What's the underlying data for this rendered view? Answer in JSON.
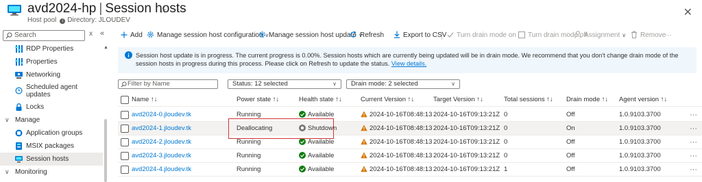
{
  "header": {
    "resource_name": "avd2024-hp",
    "page_name": "Session hosts",
    "separator": "|",
    "subtitle_type": "Host pool",
    "subtitle_directory": "Directory: JLOUDEV",
    "favorite_glyph": "☆",
    "more_glyph": "···",
    "close_glyph": "✕"
  },
  "sidebar": {
    "search_placeholder": "Search",
    "clear_glyph": "x",
    "collapse_glyph": "«",
    "items": [
      {
        "label": "RDP Properties",
        "icon": "rdp-properties-icon"
      },
      {
        "label": "Properties",
        "icon": "properties-icon"
      },
      {
        "label": "Networking",
        "icon": "networking-icon"
      },
      {
        "label": "Scheduled agent updates",
        "icon": "clock-icon"
      },
      {
        "label": "Locks",
        "icon": "lock-icon"
      }
    ],
    "manage_group": "Manage",
    "manage_items": [
      {
        "label": "Application groups",
        "icon": "application-groups-icon"
      },
      {
        "label": "MSIX packages",
        "icon": "msix-packages-icon"
      },
      {
        "label": "Session hosts",
        "icon": "session-hosts-icon",
        "selected": true
      }
    ],
    "monitoring_group": "Monitoring"
  },
  "toolbar": {
    "add": "Add",
    "manage_config": "Manage session host configuration",
    "manage_update": "Manage session host update",
    "refresh": "Refresh",
    "export": "Export to CSV",
    "drain_on": "Turn drain mode on",
    "drain_off": "Turn drain mode off",
    "assignment": "Assignment",
    "remove": "Remove",
    "more": "···"
  },
  "banner": {
    "message": "Session host update is in progress. The current progress is 0.00%. Session hosts which are currently being updated will be in drain mode. We recommend that you don't change drain mode of the session hosts in progress during this process. Please click on Refresh to update the status.",
    "link": "View details."
  },
  "filters": {
    "name_placeholder": "Filter by Name",
    "status": "Status: 12 selected",
    "drain_mode": "Drain mode: 2 selected"
  },
  "table": {
    "columns": [
      "Name ↑↓",
      "Power state ↑↓",
      "Health state ↑↓",
      "Current Version ↑↓",
      "Target Version ↑↓",
      "Total sessions ↑↓",
      "Drain mode ↑↓",
      "Agent version ↑↓"
    ],
    "rows": [
      {
        "name": "avd2024-0.jloudev.tk",
        "power": "Running",
        "health": "Available",
        "current": "2024-10-16T08:48:13.0...",
        "target": "2024-10-16T09:13:21Z",
        "sessions": "0",
        "drain": "Off",
        "agent": "1.0.9103.3700"
      },
      {
        "name": "avd2024-1.jloudev.tk",
        "power": "Deallocating",
        "health": "Shutdown",
        "current": "2024-10-16T08:48:13.0...",
        "target": "2024-10-16T09:13:21Z",
        "sessions": "0",
        "drain": "On",
        "agent": "1.0.9103.3700"
      },
      {
        "name": "avd2024-2.jloudev.tk",
        "power": "Running",
        "health": "Available",
        "current": "2024-10-16T08:48:13.0...",
        "target": "2024-10-16T09:13:21Z",
        "sessions": "0",
        "drain": "Off",
        "agent": "1.0.9103.3700"
      },
      {
        "name": "avd2024-3.jloudev.tk",
        "power": "Running",
        "health": "Available",
        "current": "2024-10-16T08:48:13.0...",
        "target": "2024-10-16T09:13:21Z",
        "sessions": "0",
        "drain": "Off",
        "agent": "1.0.9103.3700"
      },
      {
        "name": "avd2024-4.jloudev.tk",
        "power": "Running",
        "health": "Available",
        "current": "2024-10-16T08:48:13.0...",
        "target": "2024-10-16T09:13:21Z",
        "sessions": "1",
        "drain": "Off",
        "agent": "1.0.9103.3700"
      }
    ],
    "row_more": "···"
  },
  "colors": {
    "accent": "#0078d4",
    "available": "#107c10",
    "warning": "#d47500",
    "annotation": "#d13438",
    "banner_bg": "#eff6fc"
  }
}
